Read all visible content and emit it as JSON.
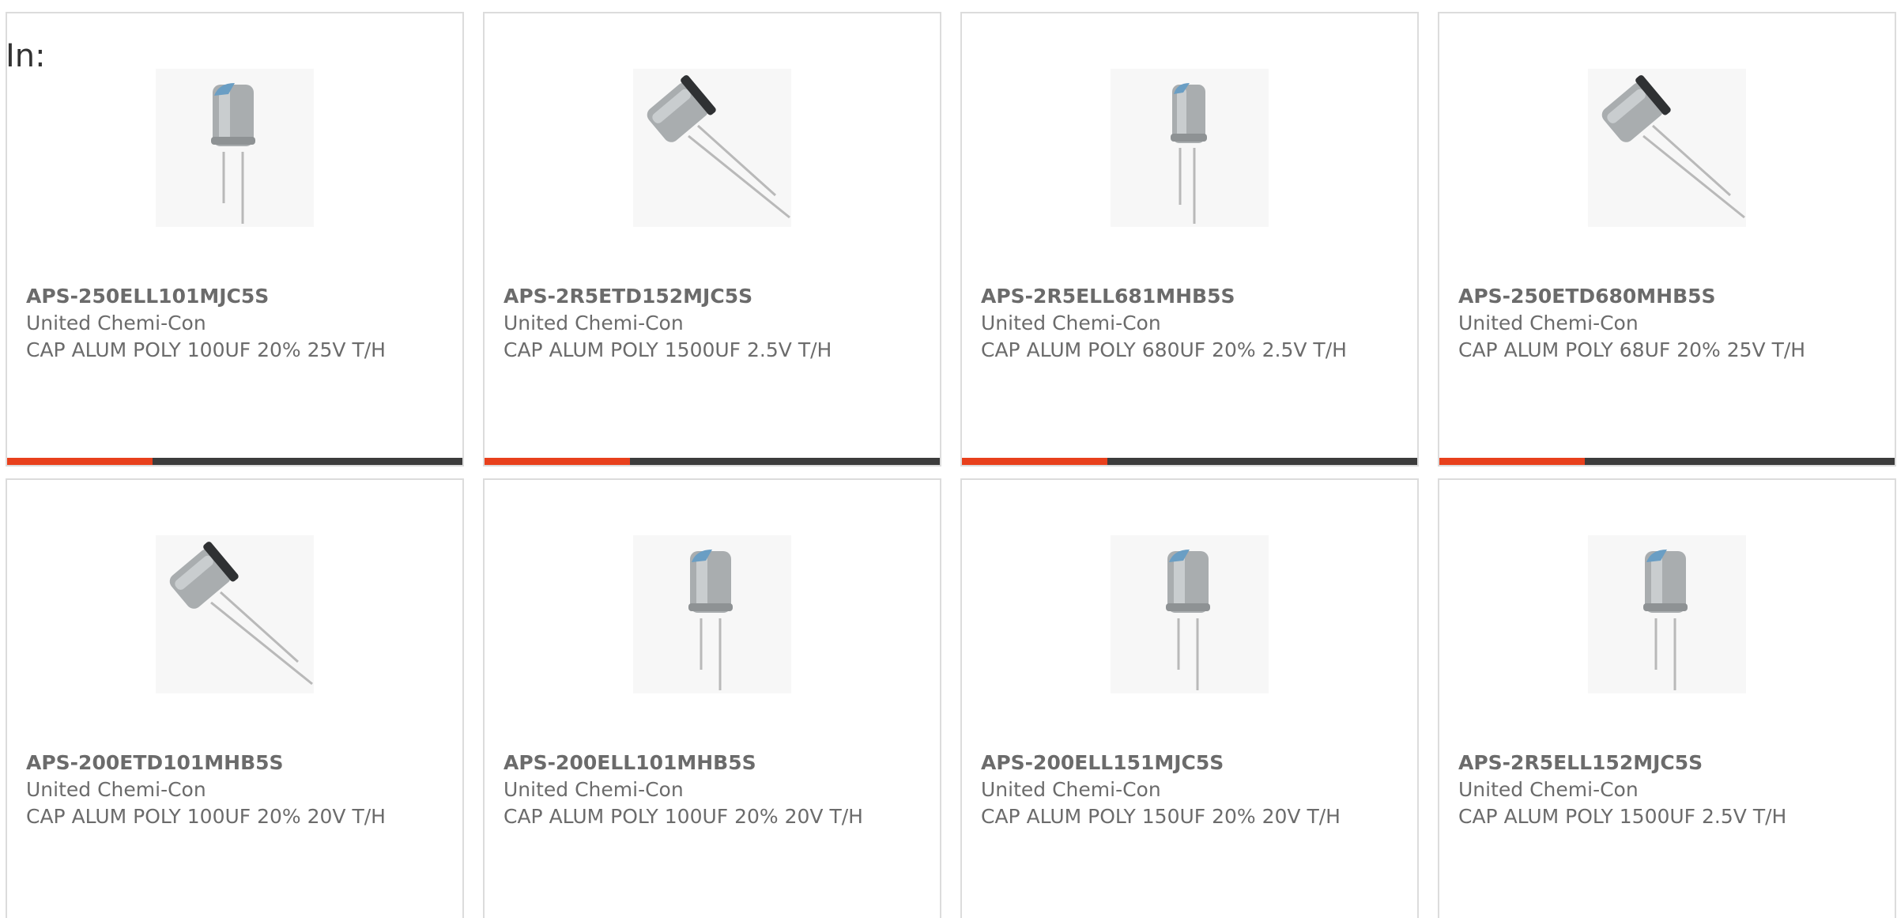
{
  "filter_label": "In:",
  "accent_color": "#e8401c",
  "bar_color": "#3c3c3c",
  "products": [
    {
      "part_number": "APS-250ELL101MJC5S",
      "manufacturer": "United Chemi-Con",
      "description": "CAP ALUM POLY 100UF 20% 25V T/H",
      "image_icon": "capacitor-upright-icon",
      "progress": 0.32
    },
    {
      "part_number": "APS-2R5ETD152MJC5S",
      "manufacturer": "United Chemi-Con",
      "description": "CAP ALUM POLY 1500UF 2.5V T/H",
      "image_icon": "capacitor-tilted-icon",
      "progress": 0.32
    },
    {
      "part_number": "APS-2R5ELL681MHB5S",
      "manufacturer": "United Chemi-Con",
      "description": "CAP ALUM POLY 680UF 20% 2.5V T/H",
      "image_icon": "capacitor-upright-icon",
      "progress": 0.32
    },
    {
      "part_number": "APS-250ETD680MHB5S",
      "manufacturer": "United Chemi-Con",
      "description": "CAP ALUM POLY 68UF 20% 25V T/H",
      "image_icon": "capacitor-tilted-icon",
      "progress": 0.32
    },
    {
      "part_number": "APS-200ETD101MHB5S",
      "manufacturer": "United Chemi-Con",
      "description": "CAP ALUM POLY 100UF 20% 20V T/H",
      "image_icon": "capacitor-tilted-icon",
      "progress": null
    },
    {
      "part_number": "APS-200ELL101MHB5S",
      "manufacturer": "United Chemi-Con",
      "description": "CAP ALUM POLY 100UF 20% 20V T/H",
      "image_icon": "capacitor-upright-icon",
      "progress": null
    },
    {
      "part_number": "APS-200ELL151MJC5S",
      "manufacturer": "United Chemi-Con",
      "description": "CAP ALUM POLY 150UF 20% 20V T/H",
      "image_icon": "capacitor-upright-icon",
      "progress": null
    },
    {
      "part_number": "APS-2R5ELL152MJC5S",
      "manufacturer": "United Chemi-Con",
      "description": "CAP ALUM POLY 1500UF 2.5V T/H",
      "image_icon": "capacitor-upright-icon",
      "progress": null
    }
  ]
}
